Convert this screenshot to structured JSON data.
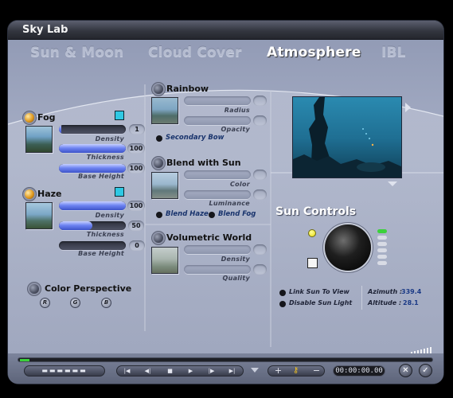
{
  "window": {
    "title": "Sky Lab"
  },
  "tabs": [
    {
      "label": "Sun & Moon",
      "active": false
    },
    {
      "label": "Cloud Cover",
      "active": false
    },
    {
      "label": "Atmosphere",
      "active": true
    },
    {
      "label": "IBL",
      "active": false
    }
  ],
  "fog": {
    "label": "Fog",
    "density": {
      "label": "Density",
      "value": "1"
    },
    "thickness": {
      "label": "Thickness",
      "value": "100"
    },
    "base_height": {
      "label": "Base Height",
      "value": "100"
    }
  },
  "haze": {
    "label": "Haze",
    "density": {
      "label": "Density",
      "value": "100"
    },
    "thickness": {
      "label": "Thickness",
      "value": "50"
    },
    "base_height": {
      "label": "Base Height",
      "value": "0"
    }
  },
  "color_perspective": {
    "label": "Color Perspective",
    "r": "R",
    "g": "G",
    "b": "B"
  },
  "rainbow": {
    "label": "Rainbow",
    "radius_label": "Radius",
    "opacity_label": "Opacity",
    "secondary_bow": "Secondary Bow"
  },
  "blend_with_sun": {
    "label": "Blend with Sun",
    "color_label": "Color",
    "luminance_label": "Luminance",
    "blend_haze": "Blend Haze",
    "blend_fog": "Blend Fog"
  },
  "volumetric_world": {
    "label": "Volumetric World",
    "density_label": "Density",
    "quality_label": "Quality"
  },
  "sun_controls": {
    "title": "Sun Controls",
    "link_sun_to_view": "Link Sun To View",
    "disable_sun_light": "Disable Sun Light",
    "azimuth_label": "Azimuth :",
    "azimuth_value": "339.4",
    "altitude_label": "Altitude :",
    "altitude_value": "28.1"
  },
  "transport": {
    "time": "00:00:00.00"
  },
  "colors": {
    "accent_blue": "#4a63d9",
    "cyan_swatch": "#2fc8e3",
    "led_amber": "#e09a20"
  }
}
